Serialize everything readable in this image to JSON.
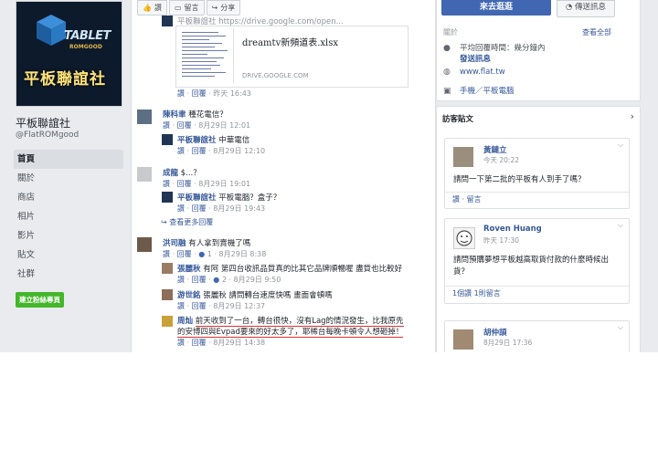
{
  "cover": {
    "brand": "TABLET",
    "brand_sub": "ROMGOOD",
    "cn_title": "平板聯誼社"
  },
  "page": {
    "name": "平板聯誼社",
    "handle": "@FlatROMgood"
  },
  "left_nav": [
    "首頁",
    "關於",
    "商店",
    "相片",
    "影片",
    "貼文",
    "社群"
  ],
  "create_page_button": "建立粉絲專頁",
  "toolbar": {
    "like": "讚",
    "comment": "留言",
    "share": "分享"
  },
  "top_comment": {
    "author_text": "平板聯誼社  https://drive.google.com/open..."
  },
  "attachment": {
    "filename": "dreamtv新頻道表.xlsx",
    "domain": "DRIVE.GOOGLE.COM",
    "meta": {
      "like": "讚",
      "reply": "回覆",
      "time": "昨天 16:43"
    }
  },
  "comments": [
    {
      "author": "陳科聿",
      "text": "種花電信？",
      "like": "讚",
      "reply": "回覆",
      "time": "8月29日 12:01"
    },
    {
      "author": "平板聯誼社",
      "text": "中華電信",
      "like": "讚",
      "reply": "回覆",
      "time": "8月29日 12:10"
    },
    {
      "author": "成龍",
      "text": "$...？",
      "like": "讚",
      "reply": "回覆",
      "time": "8月29日 19:01"
    },
    {
      "author": "平板聯誼社",
      "text": "平板電腦？盒子？",
      "like": "讚",
      "reply": "回覆",
      "time": "8月29日 19:43"
    },
    {
      "author": "洪司融",
      "text": "有人拿到賣機了嗎",
      "like": "讚",
      "reply": "回覆",
      "reactions": "1",
      "time": "8月29日 8:38"
    },
    {
      "author": "張麗秋",
      "text": "有阿 第四台收訊品質真的比其它品牌順暢喔 盡質也比較好",
      "like": "讚",
      "reply": "回覆",
      "reactions": "2",
      "time": "8月29日 9:50"
    },
    {
      "author": "游世銘",
      "text": "張麗秋 請問轉台速度快嗎 畫面會頓嗎",
      "like": "讚",
      "reply": "回覆",
      "time": "8月29日 12:37"
    },
    {
      "author": "周灿",
      "text_line1": "前天收到了一台，轉台很快，沒有Lag的情況發生，比我原先",
      "text_line2": "的安博四與Evpad要來的好太多了，耶稀台每晚卡頓令人想砸掉！",
      "like": "讚",
      "reply": "回覆",
      "time": "8月29日 14:38"
    }
  ],
  "more_replies": "查看更多回覆",
  "header_buttons": {
    "go": "來去逛逛",
    "message": "傳送訊息"
  },
  "about": {
    "label": "關於",
    "see_all": "查看全部",
    "response_line1": "平均回覆時間：幾分鐘內",
    "response_line2": "發送訊息",
    "website": "www.flat.tw",
    "category": "手機／平板電腦"
  },
  "visitor_posts": {
    "title": "訪客貼文",
    "posts": [
      {
        "name": "黃鏈立",
        "time": "今天 20:22",
        "text": "請問一下第二批的平板有人到手了嗎？",
        "footer": "讚 · 留言"
      },
      {
        "name": "Roven Huang",
        "time": "昨天 17:30",
        "text": "請問預購夢想平板越高取貨付款的什麼時候出貨？",
        "footer": "1個讚    1則留言"
      },
      {
        "name": "胡仲頡",
        "time": "8月29日 17:36",
        "text": "",
        "footer": ""
      }
    ]
  }
}
